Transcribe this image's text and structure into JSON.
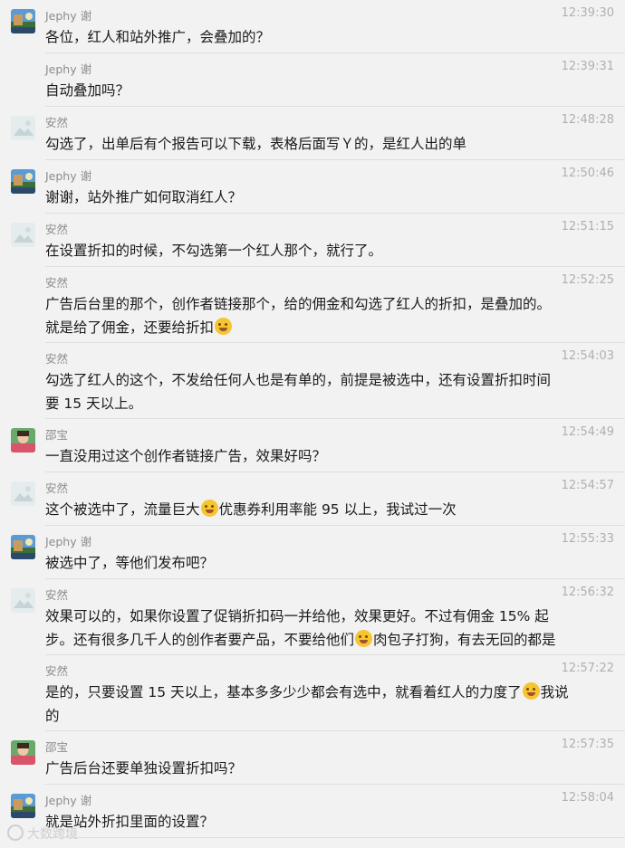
{
  "colors": {
    "background": "#f2f2f2",
    "divider": "#dedede",
    "name": "#8c8c8c",
    "time": "#b0b0b0",
    "text": "#1a1a1a"
  },
  "messages": [
    {
      "avatar": "landscape-avatar",
      "sender": "Jephy 谢",
      "time": "12:39:30",
      "text": "各位，红人和站外推广，会叠加的？",
      "lines": 1
    },
    {
      "avatar": "",
      "sender": "Jephy 谢",
      "time": "12:39:31",
      "text": "自动叠加吗？",
      "lines": 1
    },
    {
      "avatar": "placeholder-avatar",
      "sender": "安然",
      "time": "12:48:28",
      "text": "勾选了，出单后有个报告可以下载，表格后面写Ｙ的，是红人出的单",
      "lines": 1
    },
    {
      "avatar": "landscape-avatar",
      "sender": "Jephy 谢",
      "time": "12:50:46",
      "text": "谢谢，站外推广如何取消红人？",
      "lines": 1
    },
    {
      "avatar": "placeholder-avatar",
      "sender": "安然",
      "time": "12:51:15",
      "text": "在设置折扣的时候，不勾选第一个红人那个，就行了。",
      "lines": 1
    },
    {
      "avatar": "",
      "sender": "安然",
      "time": "12:52:25",
      "text": "广告后台里的那个，创作者链接那个，给的佣金和勾选了红人的折扣，是叠加的。",
      "text2": "就是给了佣金，还要给折扣",
      "lines": 2
    },
    {
      "avatar": "",
      "sender": "安然",
      "time": "12:54:03",
      "text": "勾选了红人的这个，不发给任何人也是有单的，前提是被选中，还有设置折扣时间",
      "text2": "要 15 天以上。",
      "lines": 2
    },
    {
      "avatar": "person-avatar",
      "sender": "邵宝",
      "time": "12:54:49",
      "text": "一直没用过这个创作者链接广告，效果好吗？",
      "lines": 1
    },
    {
      "avatar": "placeholder-avatar",
      "sender": "安然",
      "time": "12:54:57",
      "text": "这个被选中了，流量巨大",
      "text_after": "优惠券利用率能 95 以上，我试过一次",
      "lines": 1
    },
    {
      "avatar": "landscape-avatar",
      "sender": "Jephy 谢",
      "time": "12:55:33",
      "text": "被选中了，等他们发布吧？",
      "lines": 1
    },
    {
      "avatar": "placeholder-avatar",
      "sender": "安然",
      "time": "12:56:32",
      "text": "效果可以的，如果你设置了促销折扣码一并给他，效果更好。不过有佣金 15% 起",
      "text2": "步。还有很多几千人的创作者要产品，不要给他们",
      "text2_after": "肉包子打狗，有去无回的都是",
      "lines": 2
    },
    {
      "avatar": "",
      "sender": "安然",
      "time": "12:57:22",
      "text": "是的，只要设置 15 天以上，基本多多少少都会有选中，就看着红人的力度了",
      "text_after": "我说",
      "text2": "的",
      "lines": 2
    },
    {
      "avatar": "person-avatar",
      "sender": "邵宝",
      "time": "12:57:35",
      "text": "广告后台还要单独设置折扣吗？",
      "lines": 1
    },
    {
      "avatar": "landscape-avatar",
      "sender": "Jephy 谢",
      "time": "12:58:04",
      "text": "就是站外折扣里面的设置？",
      "lines": 1
    }
  ],
  "watermark": "大数跨境"
}
